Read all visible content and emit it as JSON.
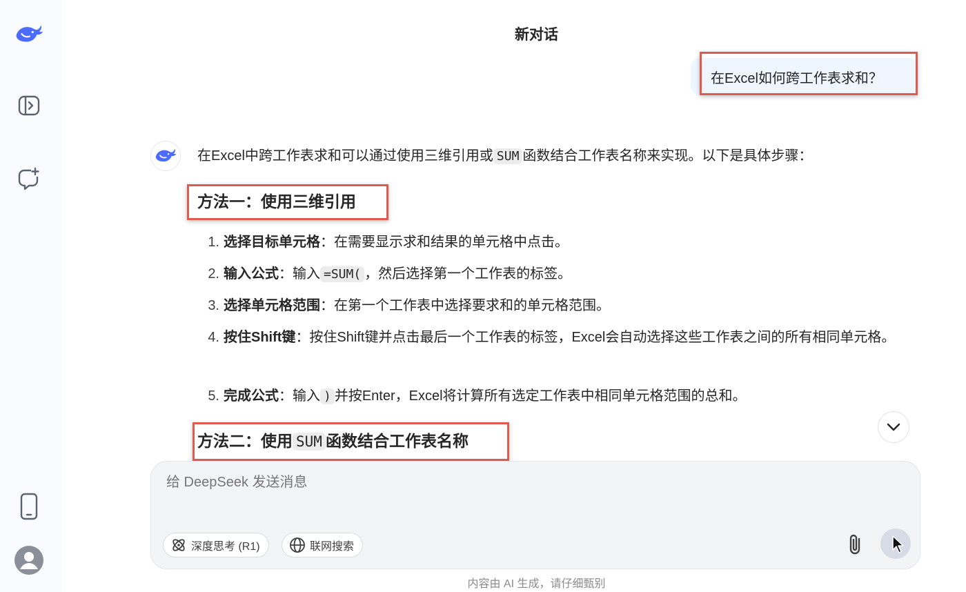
{
  "header": {
    "title": "新对话"
  },
  "user_message": {
    "text": "在Excel如何跨工作表求和？"
  },
  "answer": {
    "intro_before": "在Excel中跨工作表求和可以通过使用三维引用或",
    "intro_code": "SUM",
    "intro_after": "函数结合工作表名称来实现。以下是具体步骤：",
    "method1_title": "方法一：使用三维引用",
    "steps": [
      {
        "num": "1.",
        "bold": "选择目标单元格",
        "text": "：在需要显示求和结果的单元格中点击。"
      },
      {
        "num": "2.",
        "bold": "输入公式",
        "text_before": "：输入",
        "code": "=SUM(",
        "text_after": "，然后选择第一个工作表的标签。"
      },
      {
        "num": "3.",
        "bold": "选择单元格范围",
        "text": "：在第一个工作表中选择要求和的单元格范围。"
      },
      {
        "num": "4.",
        "bold": "按住Shift键",
        "text": "：按住Shift键并点击最后一个工作表的标签，Excel会自动选择这些工作表之间的所有相同单元格。"
      },
      {
        "num": "5.",
        "bold": "完成公式",
        "text_before": "：输入",
        "code": ")",
        "text_after": "并按Enter，Excel将计算所有选定工作表中相同单元格范围的总和。"
      }
    ],
    "method2_title_before": "方法二：使用",
    "method2_code": "SUM",
    "method2_title_after": "函数结合工作表名称"
  },
  "composer": {
    "placeholder": "给 DeepSeek 发送消息",
    "deep_think_label": "深度思考 (R1)",
    "web_search_label": "联网搜索"
  },
  "footer": {
    "disclaimer": "内容由 AI 生成，请仔细甄别"
  },
  "colors": {
    "accent": "#4d6bfe",
    "highlight_box": "#e05a4e",
    "user_bubble": "#eff6ff"
  },
  "icons": [
    "deepseek-logo-icon",
    "open-sidebar-icon",
    "new-chat-icon",
    "mobile-app-icon",
    "user-avatar-icon",
    "chevron-down-icon",
    "deep-think-icon",
    "globe-icon",
    "paperclip-icon",
    "send-icon",
    "cursor-icon"
  ]
}
